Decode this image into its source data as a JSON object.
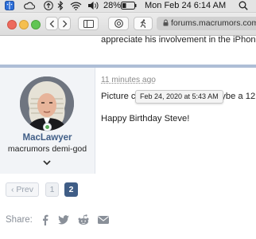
{
  "menubar": {
    "battery": "28%",
    "datetime": "Mon Feb 24  6:14 AM"
  },
  "browser": {
    "address": "forums.macrumors.com"
  },
  "thread": {
    "previous_post_text": "appreciate his involvement in the iPhone.",
    "post": {
      "username": "MacLawyer",
      "user_title": "macrumors demi-god",
      "time_ago": "11 minutes ago",
      "tooltip": "Feb 24, 2020 at 5:43 AM",
      "line1_start": "Picture ca",
      "line1_end": "maybe a 12",
      "line2": "Happy Birthday Steve!"
    },
    "pagination": {
      "prev_label": "‹ Prev",
      "pages": [
        "1",
        "2"
      ],
      "current_page": "2"
    },
    "share": {
      "label": "Share:",
      "targets": [
        "facebook-icon",
        "twitter-icon",
        "reddit-icon",
        "email-icon"
      ]
    }
  },
  "colors": {
    "accent": "#3f5d86",
    "separator": "#aebed6",
    "online": "#5aa95a"
  }
}
